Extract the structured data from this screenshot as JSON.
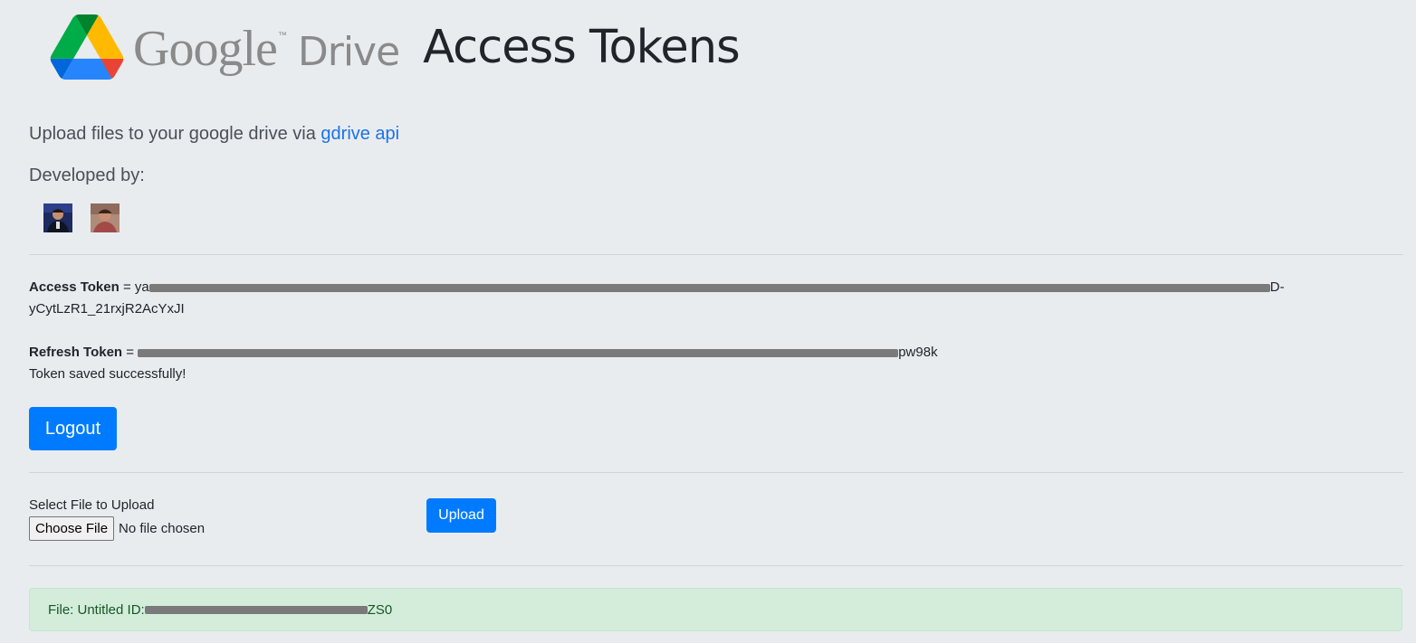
{
  "header": {
    "logo_google": "Google",
    "logo_tm": "™",
    "logo_drive": "Drive",
    "title": "Access Tokens"
  },
  "intro": {
    "text": "Upload files to your google drive via ",
    "link_text": "gdrive api",
    "developed_by": "Developed by:"
  },
  "tokens": {
    "access_label": "Access Token",
    "access_eq": " = ",
    "access_prefix": "ya",
    "access_tail": "D-",
    "access_line2": "yCytLzR1_21rxjR2AcYxJI",
    "refresh_label": "Refresh Token",
    "refresh_eq": " = ",
    "refresh_tail": "pw98k",
    "saved_msg": "Token saved successfully!"
  },
  "logout_label": "Logout",
  "upload": {
    "label": "Select File to Upload",
    "choose_label": "Choose File",
    "status": "No file chosen",
    "button": "Upload"
  },
  "result": {
    "prefix": "File: Untitled ID: ",
    "id_tail": "ZS0"
  },
  "colors": {
    "background": "#e9ecef",
    "primary": "#007bff",
    "link": "#1a73e8",
    "success_bg": "#d4eddb",
    "success_text": "#155724"
  }
}
